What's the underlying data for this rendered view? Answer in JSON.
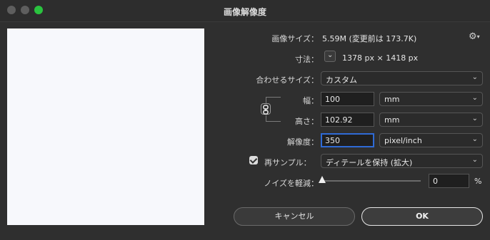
{
  "window": {
    "title": "画像解像度"
  },
  "image_size": {
    "label": "画像サイズ：",
    "value": "5.59M (変更前は 173.7K)"
  },
  "dimensions": {
    "label": "寸法：",
    "value": "1378 px × 1418 px"
  },
  "fit_to": {
    "label": "合わせるサイズ：",
    "selected": "カスタム"
  },
  "width": {
    "label": "幅：",
    "value": "100",
    "unit": "mm"
  },
  "height": {
    "label": "高さ：",
    "value": "102.92",
    "unit": "mm"
  },
  "resolution": {
    "label": "解像度：",
    "value": "350",
    "unit": "pixel/inch"
  },
  "resample": {
    "label": "再サンプル：",
    "checked": true,
    "selected": "ディテールを保持 (拡大)"
  },
  "noise": {
    "label": "ノイズを軽減：",
    "value": "0",
    "unit": "%"
  },
  "buttons": {
    "cancel": "キャンセル",
    "ok": "OK"
  },
  "icons": {
    "gear": "gear-icon",
    "chain": "link-icon",
    "chevron": "chevron-down-icon"
  },
  "colors": {
    "accent_focus": "#2f6bd6",
    "zoom_button": "#2ac33f"
  }
}
